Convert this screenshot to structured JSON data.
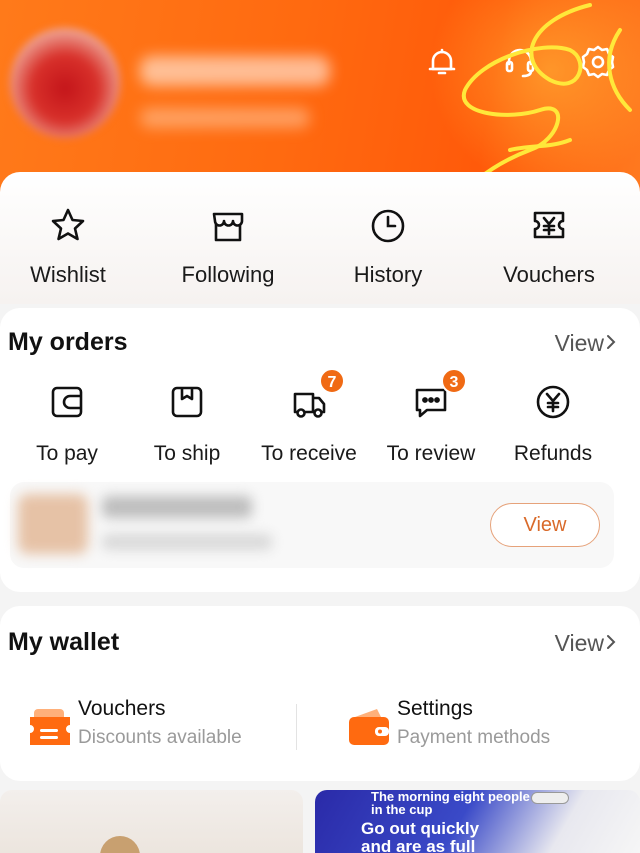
{
  "header": {
    "icons": [
      "bell-icon",
      "headset-icon",
      "gear-icon"
    ]
  },
  "quick_links": [
    {
      "label": "Wishlist",
      "icon": "star-icon"
    },
    {
      "label": "Following",
      "icon": "store-icon"
    },
    {
      "label": "History",
      "icon": "clock-icon"
    },
    {
      "label": "Vouchers",
      "icon": "yen-ticket-icon"
    }
  ],
  "orders": {
    "title": "My orders",
    "view_label": "View",
    "items": [
      {
        "label": "To pay",
        "icon": "wallet-icon",
        "badge": null
      },
      {
        "label": "To ship",
        "icon": "box-icon",
        "badge": null
      },
      {
        "label": "To receive",
        "icon": "truck-icon",
        "badge": "7"
      },
      {
        "label": "To review",
        "icon": "chat-icon",
        "badge": "3"
      },
      {
        "label": "Refunds",
        "icon": "yen-circle-icon",
        "badge": null
      }
    ],
    "recent_view_button": "View"
  },
  "wallet": {
    "title": "My wallet",
    "view_label": "View",
    "items": [
      {
        "title": "Vouchers",
        "subtitle": "Discounts available",
        "icon": "voucher-icon"
      },
      {
        "title": "Settings",
        "subtitle": "Payment methods",
        "icon": "wallet-icon"
      }
    ]
  },
  "banners": {
    "right_small": "The morning eight people in the cup",
    "right_big_line1": "Go out quickly",
    "right_big_line2": "and are as full"
  },
  "colors": {
    "accent": "#ff6a10",
    "badge": "#f06a14"
  }
}
